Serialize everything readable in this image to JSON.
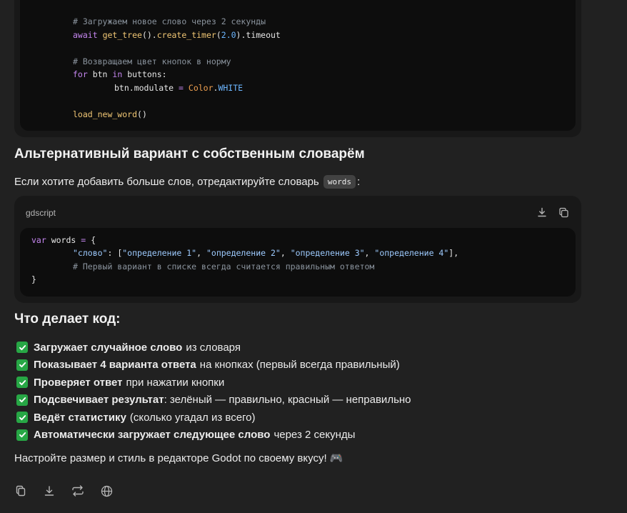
{
  "top_code": {
    "lines": [
      {
        "indent": 1,
        "tokens": [
          {
            "t": "# Загружаем новое слово через 2 секунды",
            "c": "c-cmt"
          }
        ]
      },
      {
        "indent": 1,
        "tokens": [
          {
            "t": "await",
            "c": "c-kw"
          },
          {
            "t": " ",
            "c": ""
          },
          {
            "t": "get_tree",
            "c": "c-fn"
          },
          {
            "t": "().",
            "c": "c-var"
          },
          {
            "t": "create_timer",
            "c": "c-fn"
          },
          {
            "t": "(",
            "c": "c-var"
          },
          {
            "t": "2.0",
            "c": "c-num"
          },
          {
            "t": ").timeout",
            "c": "c-var"
          }
        ]
      },
      {
        "indent": 0,
        "tokens": []
      },
      {
        "indent": 1,
        "tokens": [
          {
            "t": "# Возвращаем цвет кнопок в норму",
            "c": "c-cmt"
          }
        ]
      },
      {
        "indent": 1,
        "tokens": [
          {
            "t": "for",
            "c": "c-kw"
          },
          {
            "t": " btn ",
            "c": "c-var"
          },
          {
            "t": "in",
            "c": "c-kw"
          },
          {
            "t": " buttons:",
            "c": "c-var"
          }
        ]
      },
      {
        "indent": 2,
        "tokens": [
          {
            "t": "btn.modulate ",
            "c": "c-var"
          },
          {
            "t": "=",
            "c": "c-op"
          },
          {
            "t": " ",
            "c": ""
          },
          {
            "t": "Color",
            "c": "c-cls"
          },
          {
            "t": ".",
            "c": "c-var"
          },
          {
            "t": "WHITE",
            "c": "c-const"
          }
        ]
      },
      {
        "indent": 0,
        "tokens": []
      },
      {
        "indent": 1,
        "tokens": [
          {
            "t": "load_new_word",
            "c": "c-fn"
          },
          {
            "t": "()",
            "c": "c-var"
          }
        ]
      }
    ]
  },
  "section1": {
    "heading": "Альтернативный вариант с собственным словарём",
    "text_before": "Если хотите добавить больше слов, отредактируйте словарь",
    "inline_code": "words",
    "text_after": ":"
  },
  "code_block": {
    "language": "gdscript",
    "download_icon": "download-icon",
    "copy_icon": "copy-icon",
    "lines": [
      {
        "indent": 0,
        "tokens": [
          {
            "t": "var",
            "c": "c-kw"
          },
          {
            "t": " words ",
            "c": "c-var"
          },
          {
            "t": "=",
            "c": "c-op"
          },
          {
            "t": " {",
            "c": "c-var"
          }
        ]
      },
      {
        "indent": 1,
        "tokens": [
          {
            "t": "\"слово\"",
            "c": "c-str"
          },
          {
            "t": ": [",
            "c": "c-var"
          },
          {
            "t": "\"определение 1\"",
            "c": "c-str"
          },
          {
            "t": ", ",
            "c": "c-var"
          },
          {
            "t": "\"определение 2\"",
            "c": "c-str"
          },
          {
            "t": ", ",
            "c": "c-var"
          },
          {
            "t": "\"определение 3\"",
            "c": "c-str"
          },
          {
            "t": ", ",
            "c": "c-var"
          },
          {
            "t": "\"определение 4\"",
            "c": "c-str"
          },
          {
            "t": "],",
            "c": "c-var"
          }
        ]
      },
      {
        "indent": 1,
        "tokens": [
          {
            "t": "# Первый вариант в списке всегда считается правильным ответом",
            "c": "c-cmt"
          }
        ]
      },
      {
        "indent": 0,
        "tokens": [
          {
            "t": "}",
            "c": "c-var"
          }
        ]
      }
    ]
  },
  "section2": {
    "heading": "Что делает код:",
    "items": [
      {
        "bold": "Загружает случайное слово",
        "rest": "из словаря"
      },
      {
        "bold": "Показывает 4 варианта ответа",
        "rest": "на кнопках (первый всегда правильный)"
      },
      {
        "bold": "Проверяет ответ",
        "rest": "при нажатии кнопки"
      },
      {
        "bold": "Подсвечивает результат",
        "rest": ": зелёный — правильно, красный — неправильно"
      },
      {
        "bold": "Ведёт статистику",
        "rest": "(сколько угадал из всего)"
      },
      {
        "bold": "Автоматически загружает следующее слово",
        "rest": "через 2 секунды"
      }
    ],
    "footer": "Настройте размер и стиль в редакторе Godot по своему вкусу! 🎮"
  },
  "actions": [
    "copy-icon",
    "download-icon",
    "regenerate-icon",
    "globe-icon"
  ],
  "colors": {
    "background": "#212121",
    "code_bg": "#0d0d0d",
    "check": "#27a745"
  }
}
